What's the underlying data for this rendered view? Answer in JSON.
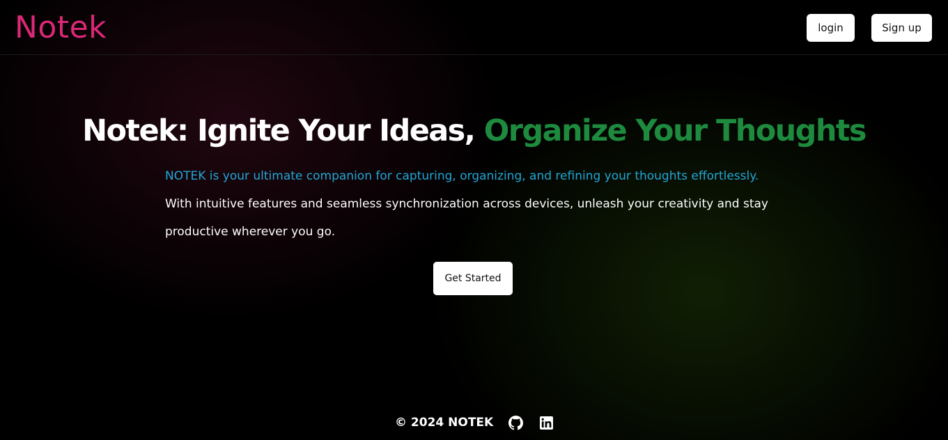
{
  "nav": {
    "logo": "Notek",
    "login_label": "login",
    "signup_label": "Sign up"
  },
  "hero": {
    "title_part1": "Notek: Ignite Your Ideas, ",
    "title_part2": "Organize Your Thoughts",
    "description_highlight": "NOTEK is your ultimate companion for capturing, organizing, and refining your thoughts effortlessly.",
    "description_rest": " With intuitive features and seamless synchronization across devices, unleash your creativity and stay productive wherever you go.",
    "cta_label": "Get Started"
  },
  "footer": {
    "copyright": "© 2024 NOTEK",
    "icons": [
      "github-icon",
      "linkedin-icon"
    ]
  },
  "colors": {
    "brand_pink": "#db2877",
    "accent_green": "#1d8a3e",
    "accent_blue": "#22a7d6",
    "button_bg": "#ffffff",
    "page_bg": "#000000"
  }
}
